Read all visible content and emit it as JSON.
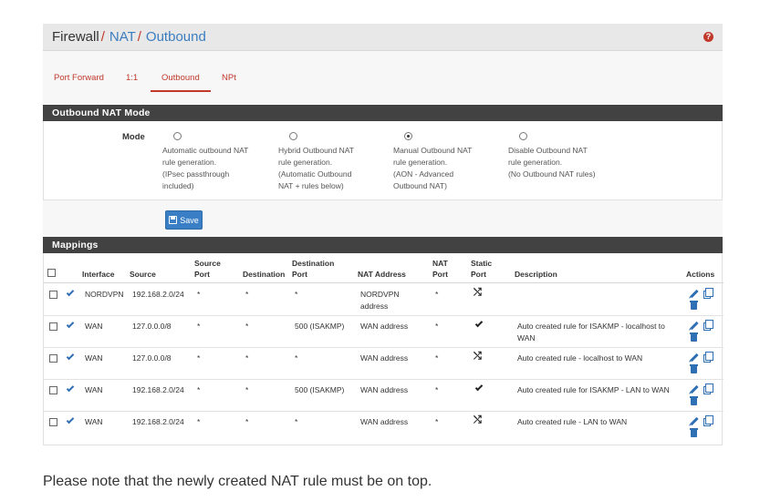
{
  "breadcrumb": {
    "root": "Firewall",
    "sep": "/",
    "level1": "NAT",
    "level2": "Outbound",
    "help": "?"
  },
  "tabs": [
    {
      "label": "Port Forward",
      "active": false
    },
    {
      "label": "1:1",
      "active": false
    },
    {
      "label": "Outbound",
      "active": true
    },
    {
      "label": "NPt",
      "active": false
    }
  ],
  "outbound_mode": {
    "heading": "Outbound NAT Mode",
    "label": "Mode",
    "options": [
      {
        "text": "Automatic outbound NAT rule generation. (IPsec passthrough included)",
        "lines": [
          "Automatic outbound NAT",
          "rule generation.",
          "(IPsec passthrough",
          "included)"
        ],
        "checked": false
      },
      {
        "text": "Hybrid Outbound NAT rule generation. (Automatic Outbound NAT + rules below)",
        "lines": [
          "Hybrid Outbound NAT",
          "rule generation.",
          "(Automatic Outbound",
          "NAT + rules below)"
        ],
        "checked": false
      },
      {
        "text": "Manual Outbound NAT rule generation. (AON - Advanced Outbound NAT)",
        "lines": [
          "Manual Outbound NAT",
          "rule generation.",
          "(AON - Advanced",
          "Outbound NAT)"
        ],
        "checked": true
      },
      {
        "text": "Disable Outbound NAT rule generation. (No Outbound NAT rules)",
        "lines": [
          "Disable Outbound NAT",
          "rule generation.",
          "(No Outbound NAT rules)"
        ],
        "checked": false
      }
    ]
  },
  "save_label": "Save",
  "mappings": {
    "heading": "Mappings",
    "headers": {
      "interface": "Interface",
      "source": "Source",
      "source_port": [
        "Source",
        "Port"
      ],
      "destination": "Destination",
      "destination_port": [
        "Destination",
        "Port"
      ],
      "nat_address": "NAT Address",
      "nat_port": [
        "NAT",
        "Port"
      ],
      "static_port": [
        "Static",
        "Port"
      ],
      "description": "Description",
      "actions": "Actions"
    },
    "rows": [
      {
        "interface": "NORDVPN",
        "source": "192.168.2.0/24",
        "source_port": "*",
        "destination": "*",
        "destination_port": "*",
        "nat_address": [
          "NORDVPN",
          "address"
        ],
        "nat_port": "*",
        "static_port": "shuffle",
        "description": []
      },
      {
        "interface": "WAN",
        "source": "127.0.0.0/8",
        "source_port": "*",
        "destination": "*",
        "destination_port": "500 (ISAKMP)",
        "nat_address": [
          "WAN address"
        ],
        "nat_port": "*",
        "static_port": "check",
        "description": [
          "Auto created rule for ISAKMP - localhost to",
          "WAN"
        ]
      },
      {
        "interface": "WAN",
        "source": "127.0.0.0/8",
        "source_port": "*",
        "destination": "*",
        "destination_port": "*",
        "nat_address": [
          "WAN address"
        ],
        "nat_port": "*",
        "static_port": "shuffle",
        "description": [
          "Auto created rule - localhost to WAN"
        ]
      },
      {
        "interface": "WAN",
        "source": "192.168.2.0/24",
        "source_port": "*",
        "destination": "*",
        "destination_port": "500 (ISAKMP)",
        "nat_address": [
          "WAN address"
        ],
        "nat_port": "*",
        "static_port": "check",
        "description": [
          "Auto created rule for ISAKMP - LAN to WAN"
        ]
      },
      {
        "interface": "WAN",
        "source": "192.168.2.0/24",
        "source_port": "*",
        "destination": "*",
        "destination_port": "*",
        "nat_address": [
          "WAN address"
        ],
        "nat_port": "*",
        "static_port": "shuffle",
        "description": [
          "Auto created rule - LAN to WAN"
        ]
      }
    ]
  },
  "note": "Please note that the newly created NAT rule must be on top.",
  "colors": {
    "accent_red": "#c0392b",
    "link_blue": "#3b7dc0",
    "button_blue": "#3a7fc6",
    "panel_dark": "#424242"
  },
  "icons": {
    "help": "help-icon",
    "enabled": "check-icon",
    "static_port_off": "shuffle-icon",
    "static_port_on": "check-icon",
    "edit": "pencil-icon",
    "copy": "copy-icon",
    "delete": "trash-icon",
    "save": "save-icon"
  }
}
